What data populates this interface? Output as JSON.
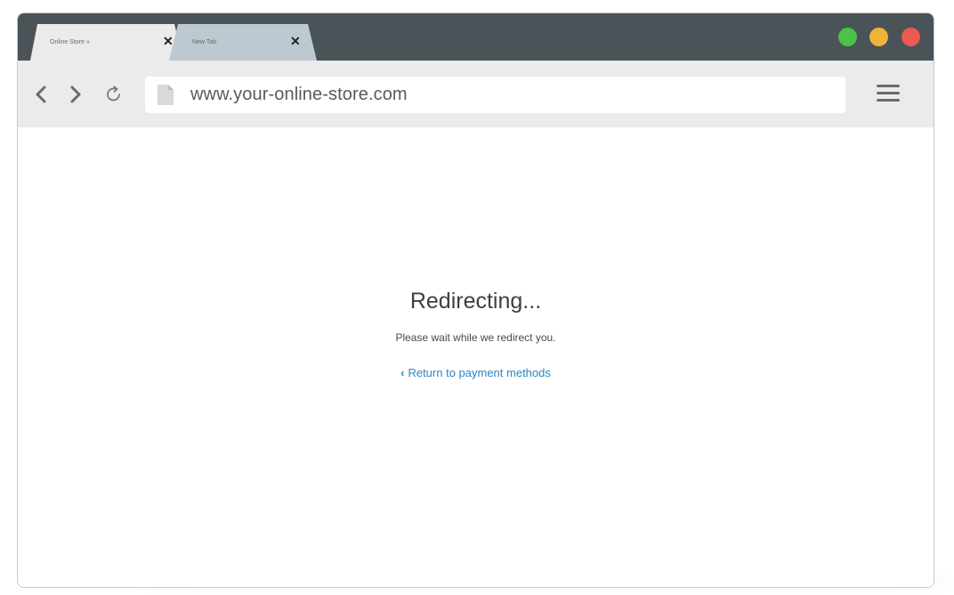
{
  "browser": {
    "tabs": [
      {
        "title": "Online Store »",
        "close": "✕"
      },
      {
        "title": "New Tab",
        "close": "✕"
      }
    ],
    "url": "www.your-online-store.com",
    "colors": {
      "titlebar": "#4a5358",
      "traffic_green": "#4cc24a",
      "traffic_yellow": "#f0b33a",
      "traffic_red": "#ec5a50"
    },
    "icons": [
      "back-arrow-icon",
      "forward-arrow-icon",
      "reload-icon",
      "page-icon",
      "hamburger-menu-icon"
    ]
  },
  "page": {
    "heading": "Redirecting...",
    "message": "Please wait while we redirect you.",
    "return_chevron": "‹",
    "return_link": "Return to payment methods",
    "link_color": "#2b86c5"
  }
}
